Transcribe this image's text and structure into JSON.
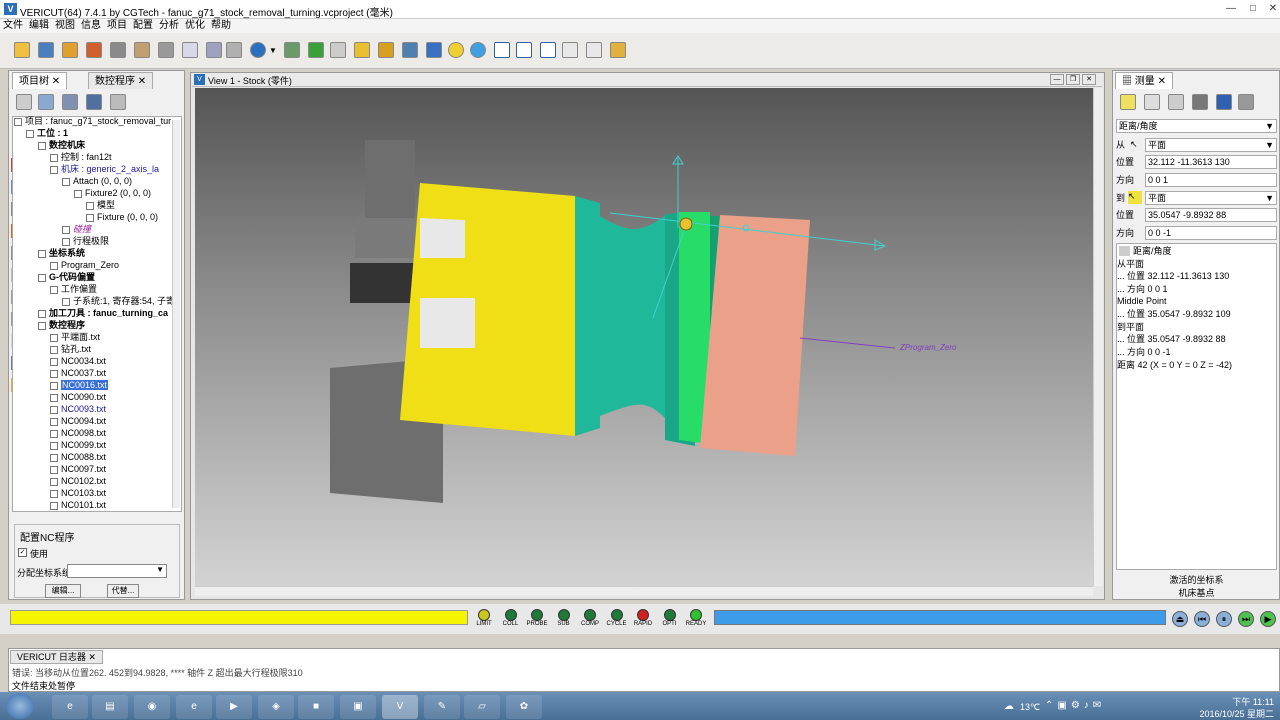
{
  "window": {
    "app": "VERICUT(64)",
    "title": "7.4.1 by CGTech - fanuc_g71_stock_removal_turning.vcproject (毫米)",
    "icon_label": "V",
    "btn_min": "—",
    "btn_max": "□",
    "btn_close": "✕"
  },
  "menu": [
    "文件",
    "编辑",
    "视图",
    "信息",
    "项目",
    "配置",
    "分析",
    "优化",
    "帮助"
  ],
  "left": {
    "tab1": "项目树",
    "tab2": "数控程序",
    "tree": [
      {
        "t": "项目 : fanuc_g71_stock_removal_tur",
        "d": 0
      },
      {
        "t": "工位 : 1",
        "d": 1
      },
      {
        "t": "数控机床",
        "d": 2
      },
      {
        "t": "控制 : fan12t",
        "d": 3
      },
      {
        "t": "机床 : generic_2_axis_la",
        "d": 3
      },
      {
        "t": "Attach (0, 0, 0)",
        "d": 4
      },
      {
        "t": "Fixture2 (0, 0, 0)",
        "d": 5
      },
      {
        "t": "模型",
        "d": 6
      },
      {
        "t": "Fixture (0, 0, 0)",
        "d": 6
      },
      {
        "t": "碰撞",
        "d": 4
      },
      {
        "t": "行程极限",
        "d": 4
      },
      {
        "t": "坐标系统",
        "d": 2
      },
      {
        "t": "Program_Zero",
        "d": 3
      },
      {
        "t": "G-代码偏置",
        "d": 2
      },
      {
        "t": "工作偏置",
        "d": 3
      },
      {
        "t": "子系统:1, 寄存器:54, 子寄",
        "d": 4
      },
      {
        "t": "加工刀具 : fanuc_turning_ca",
        "d": 2
      },
      {
        "t": "数控程序",
        "d": 2
      },
      {
        "t": "平端面.txt",
        "d": 3
      },
      {
        "t": "钻孔.txt",
        "d": 3
      },
      {
        "t": "NC0034.txt",
        "d": 3
      },
      {
        "t": "NC0037.txt",
        "d": 3
      },
      {
        "t": "NC0016.txt",
        "d": 3
      },
      {
        "t": "NC0090.txt",
        "d": 3
      },
      {
        "t": "NC0093.txt",
        "d": 3
      },
      {
        "t": "NC0094.txt",
        "d": 3
      },
      {
        "t": "NC0098.txt",
        "d": 3
      },
      {
        "t": "NC0099.txt",
        "d": 3
      },
      {
        "t": "NC0088.txt",
        "d": 3
      },
      {
        "t": "NC0097.txt",
        "d": 3
      },
      {
        "t": "NC0102.txt",
        "d": 3
      },
      {
        "t": "NC0103.txt",
        "d": 3
      },
      {
        "t": "NC0101.txt",
        "d": 3
      }
    ],
    "config_title": "配置NC程序",
    "use_label": "使用",
    "coord_label": "分配坐标系统",
    "edit_btn": "编辑...",
    "replace_btn": "代替..."
  },
  "view": {
    "title": "View 1 - Stock (零件)",
    "program_zero": "ZProgram_Zero"
  },
  "right": {
    "tab": "测量",
    "mode": "距离/角度",
    "from_label": "从",
    "from_value": "平面",
    "pos_label": "位置",
    "from_pos": "32.112 -11.3613 130",
    "dir_label": "方向",
    "from_dir": "0 0 1",
    "to_label": "到",
    "to_value": "平面",
    "to_pos": "35.0547 -9.8932 88",
    "to_dir": "0 0 -1",
    "result": [
      "距离/角度",
      "从平面",
      "... 位置 32.112 -11.3613 130",
      "... 方向 0 0 1",
      "Middle Point",
      "... 位置 35.0547 -9.8932 109",
      "到平面",
      "... 位置 35.0547 -9.8932 88",
      "... 方向 0 0 -1",
      "距离 42 (X = 0 Y = 0 Z = -42)"
    ],
    "footer1": "激活的坐标系",
    "footer2": "机床基点"
  },
  "leds": [
    {
      "label": "LIMIT",
      "color": "#c8c820"
    },
    {
      "label": "COLL",
      "color": "#1f7a3a"
    },
    {
      "label": "PROBE",
      "color": "#1f7a3a"
    },
    {
      "label": "SUB",
      "color": "#1f7a3a"
    },
    {
      "label": "COMP",
      "color": "#1f7a3a"
    },
    {
      "label": "CYCLE",
      "color": "#1f7a3a"
    },
    {
      "label": "RAPID",
      "color": "#d02020"
    },
    {
      "label": "OPTI",
      "color": "#1f7a3a"
    },
    {
      "label": "READY",
      "color": "#30c030"
    }
  ],
  "log": {
    "title": "VERICUT 日志器",
    "line1": "错误: 当移动从位置262. 452到94.9828,  **** 轴件 Z 超出最大行程极限310",
    "line2": "文件结束处暂停"
  },
  "taskbar": {
    "temp": "13℃",
    "time": "下午 11:11",
    "date": "2016/10/25 星期二"
  },
  "colors": {
    "yellow": "#f0de16",
    "teal": "#1fb89a",
    "green": "#28dc68",
    "salmon": "#eba089",
    "progress_yellow": "#f5f500",
    "progress_blue": "#3d9be9"
  }
}
